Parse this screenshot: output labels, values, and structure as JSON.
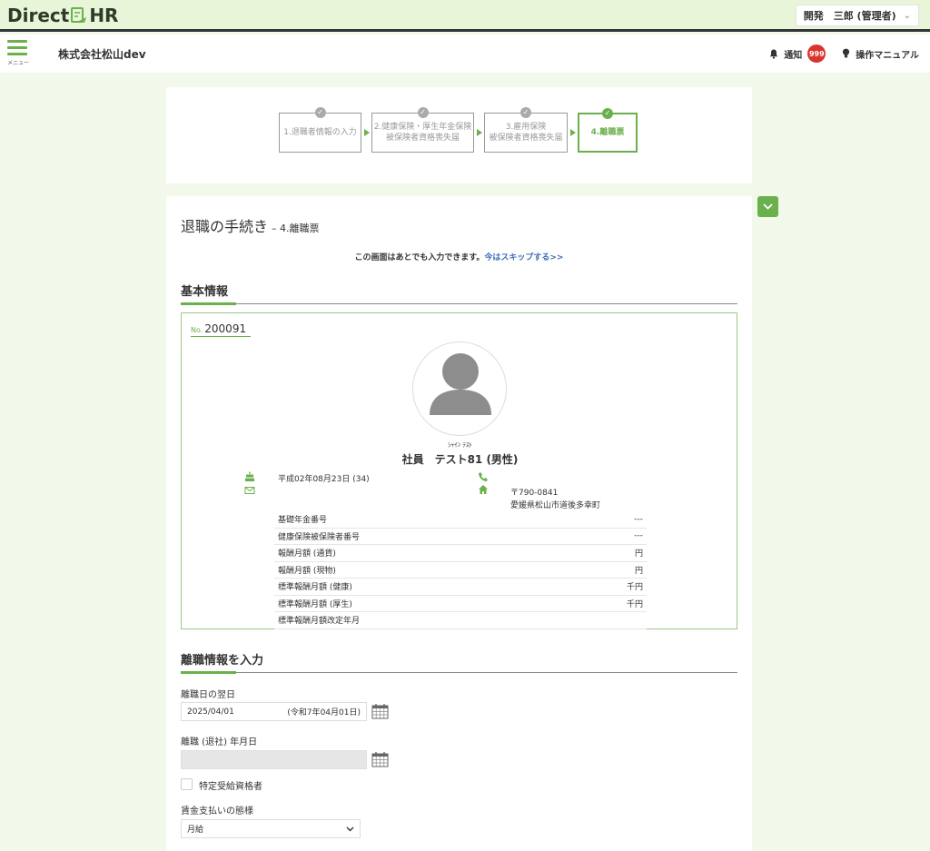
{
  "app": {
    "logo_left": "Direct",
    "logo_right": "HR",
    "user_menu": "開発　三郎 (管理者)"
  },
  "header": {
    "menu_label": "メニュー",
    "company": "株式会社松山dev",
    "notify_label": "通知",
    "notify_count": "999",
    "manual_label": "操作マニュアル"
  },
  "steps": [
    {
      "line1": "1.退職者情報の入力",
      "line2": "",
      "state": "done"
    },
    {
      "line1": "2.健康保険・厚生年金保険",
      "line2": "被保険者資格喪失届",
      "state": "done"
    },
    {
      "line1": "3.雇用保険",
      "line2": "被保険者資格喪失届",
      "state": "done"
    },
    {
      "line1": "4.離職票",
      "line2": "",
      "state": "active"
    }
  ],
  "page": {
    "title": "退職の手続き",
    "subtitle": "– 4.離職票",
    "notice": "この画面はあとでも入力できます。",
    "skip_link": "今はスキップする>>"
  },
  "basic": {
    "section_title": "基本情報",
    "no_prefix": "No.",
    "no_value": "200091",
    "kana": "ｼｬｲﾝ ﾃｽﾄ",
    "name": "社員　テスト81 (男性)",
    "birth": "平成02年08月23日 (34)",
    "zip": "〒790-0841",
    "address": "愛媛県松山市道後多幸町",
    "rows": [
      {
        "label": "基礎年金番号",
        "value": "---"
      },
      {
        "label": "健康保険被保険者番号",
        "value": "---"
      },
      {
        "label": "報酬月額 (通貨)",
        "value": "円"
      },
      {
        "label": "報酬月額 (現物)",
        "value": "円"
      },
      {
        "label": "標準報酬月額 (健康)",
        "value": "千円"
      },
      {
        "label": "標準報酬月額 (厚生)",
        "value": "千円"
      },
      {
        "label": "標準報酬月額改定年月",
        "value": ""
      }
    ]
  },
  "retire": {
    "section_title": "離職情報を入力",
    "next_day_label": "離職日の翌日",
    "next_day_value": "2025/04/01",
    "next_day_wareki": "(令和7年04月01日)",
    "retire_date_label": "離職 (退社) 年月日",
    "retire_date_value": "",
    "special_label": "特定受給資格者",
    "payment_label": "賃金支払いの態様",
    "payment_value": "月給"
  },
  "colors": {
    "accent": "#6ab04c",
    "badge": "#d9352e",
    "link": "#3b6fb6"
  }
}
